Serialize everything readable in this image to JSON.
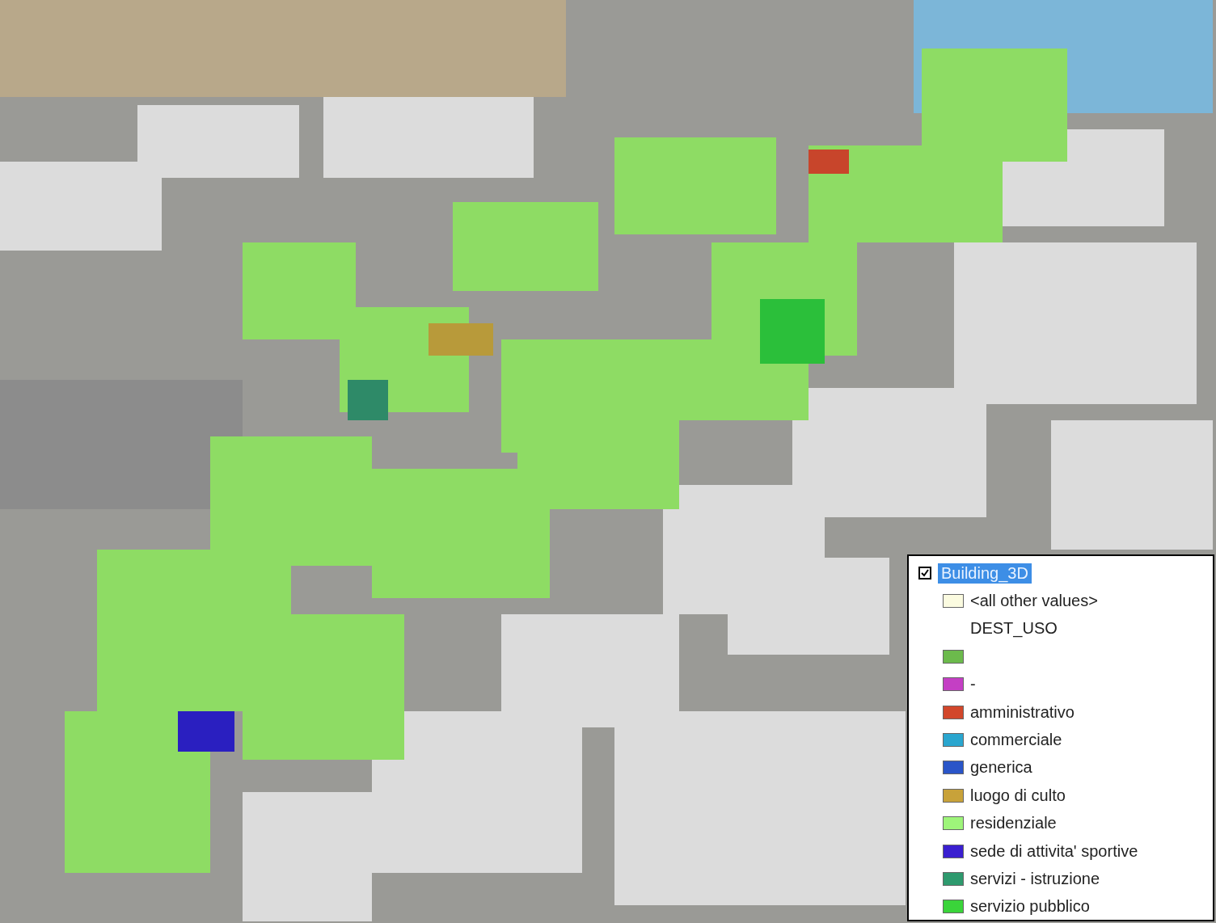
{
  "legend": {
    "layer": {
      "name": "Building_3D",
      "checked": true,
      "selected": true
    },
    "other_values": {
      "label": "<all other values>",
      "color": "#fbfbe0"
    },
    "field": "DEST_USO",
    "classes": [
      {
        "color": "#6cba4c"
      },
      {
        "label": "-",
        "color": "#c43fc4"
      },
      {
        "label": "amministrativo",
        "color": "#d2472b"
      },
      {
        "label": "commerciale",
        "color": "#2aa6cf"
      },
      {
        "label": "generica",
        "color": "#2a55c8"
      },
      {
        "label": "luogo di culto",
        "color": "#c8a23a"
      },
      {
        "label": "residenziale",
        "color": "#9ef57a"
      },
      {
        "label": "sede di attivita' sportive",
        "color": "#3a1fd0"
      },
      {
        "label": "servizi - istruzione",
        "color": "#2e9a6e"
      },
      {
        "label": "servizio pubblico",
        "color": "#3ad43a"
      }
    ]
  }
}
